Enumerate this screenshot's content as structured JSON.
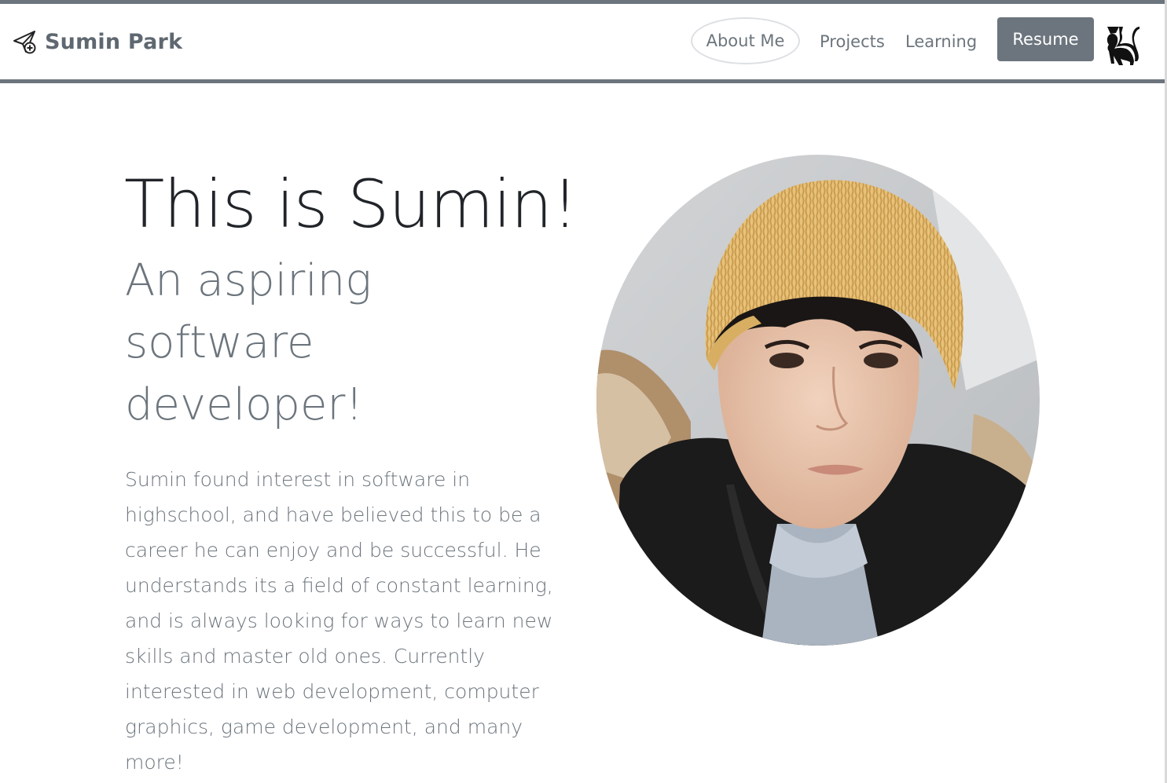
{
  "navbar": {
    "brand": {
      "name": "Sumin Park",
      "icon": "paper-plane-plus-icon"
    },
    "links": [
      {
        "label": "About Me",
        "active": true
      },
      {
        "label": "Projects",
        "active": false
      },
      {
        "label": "Learning",
        "active": false
      }
    ],
    "resume_label": "Resume",
    "cat_icon": "cat-icon"
  },
  "hero": {
    "title": "This is Sumin!",
    "subtitle": "An aspiring software developer!",
    "body": "Sumin found interest in software in highschool, and have believed this to be a career he can enjoy and be successful. He understands its a field of constant learning, and is always looking for ways to learn new skills and master old ones. Currently interested in web development, computer graphics, game development, and many more!"
  },
  "colors": {
    "accent": "#6c757d",
    "text_dark": "#212529",
    "background": "#ffffff"
  }
}
